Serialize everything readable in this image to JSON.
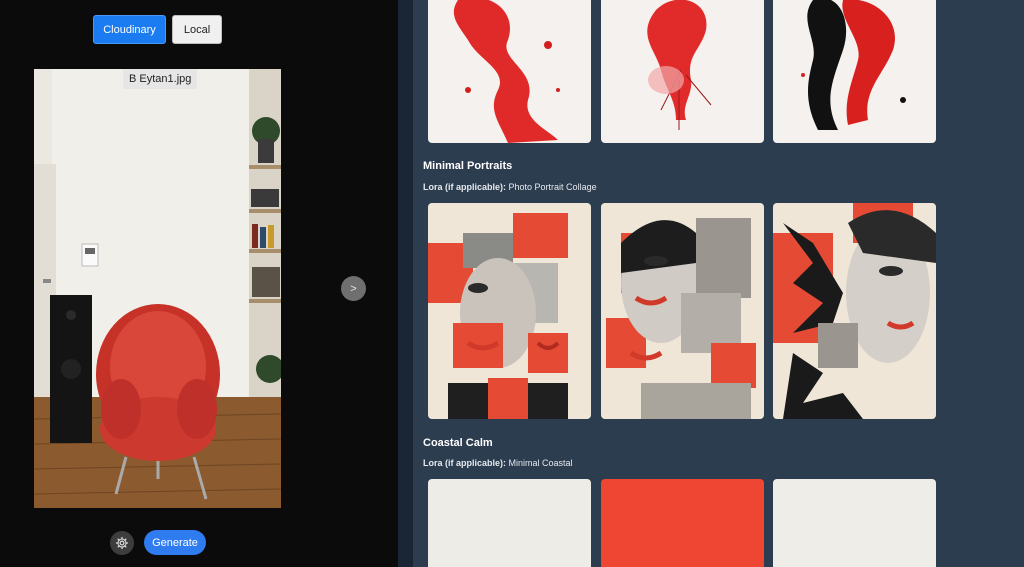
{
  "source_toggle": {
    "cloudinary_label": "Cloudinary",
    "local_label": "Local"
  },
  "preview": {
    "filename": "B Eytan1.jpg"
  },
  "actions": {
    "generate_label": "Generate",
    "next_label": ">"
  },
  "gallery": {
    "sections": [
      {
        "title": "",
        "lora_label": "",
        "lora_value": ""
      },
      {
        "title": "Minimal Portraits",
        "lora_label": "Lora (if applicable):",
        "lora_value": "Photo Portrait Collage"
      },
      {
        "title": "Coastal Calm",
        "lora_label": "Lora (if applicable):",
        "lora_value": "Minimal Coastal"
      }
    ]
  },
  "colors": {
    "accent": "#1a7cf0",
    "panel_bg": "#2d3d50",
    "left_bg": "#0b0b0b",
    "art_red": "#e63b2e"
  }
}
